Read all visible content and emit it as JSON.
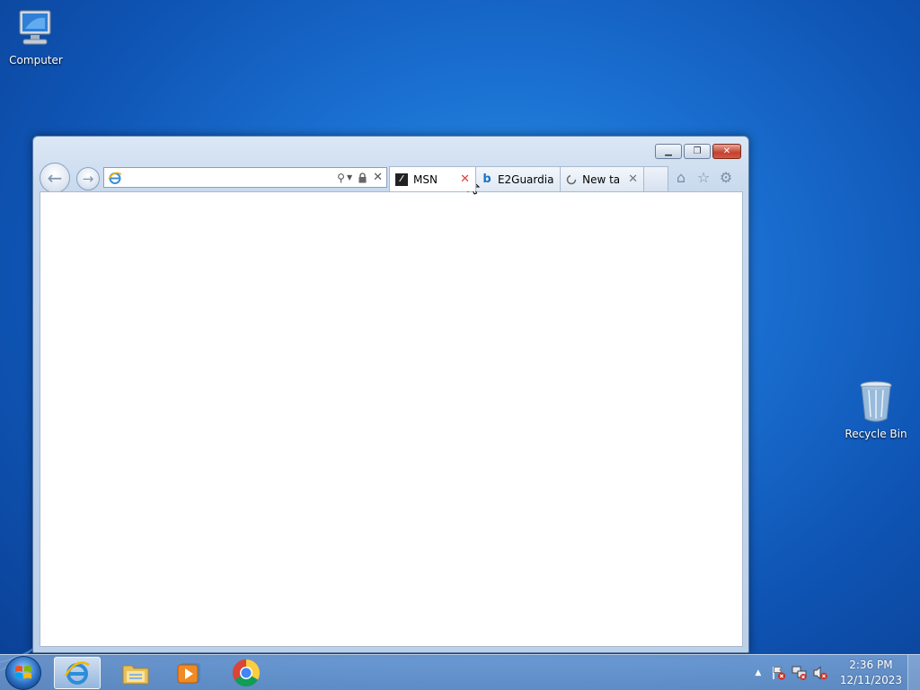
{
  "desktop": {
    "icons": [
      {
        "label": "Computer"
      },
      {
        "label": "Recycle Bin"
      }
    ]
  },
  "browser": {
    "address": {
      "value": "",
      "placeholder": ""
    },
    "tabs": [
      {
        "label": "MSN",
        "active": true
      },
      {
        "label": "E2Guardia...",
        "active": false
      },
      {
        "label": "New tab",
        "active": false
      }
    ],
    "command_icons": [
      "home-icon",
      "favorites-star-icon",
      "tools-gear-icon"
    ]
  },
  "taskbar": {
    "pinned": [
      "internet-explorer-icon",
      "windows-explorer-icon",
      "windows-media-player-icon",
      "chrome-icon"
    ],
    "clock": {
      "time": "2:36 PM",
      "date": "12/11/2023"
    }
  },
  "colors": {
    "desktop_blue": "#1a6fd0",
    "close_red": "#c4412e",
    "tab_close_red": "#e0403a"
  }
}
